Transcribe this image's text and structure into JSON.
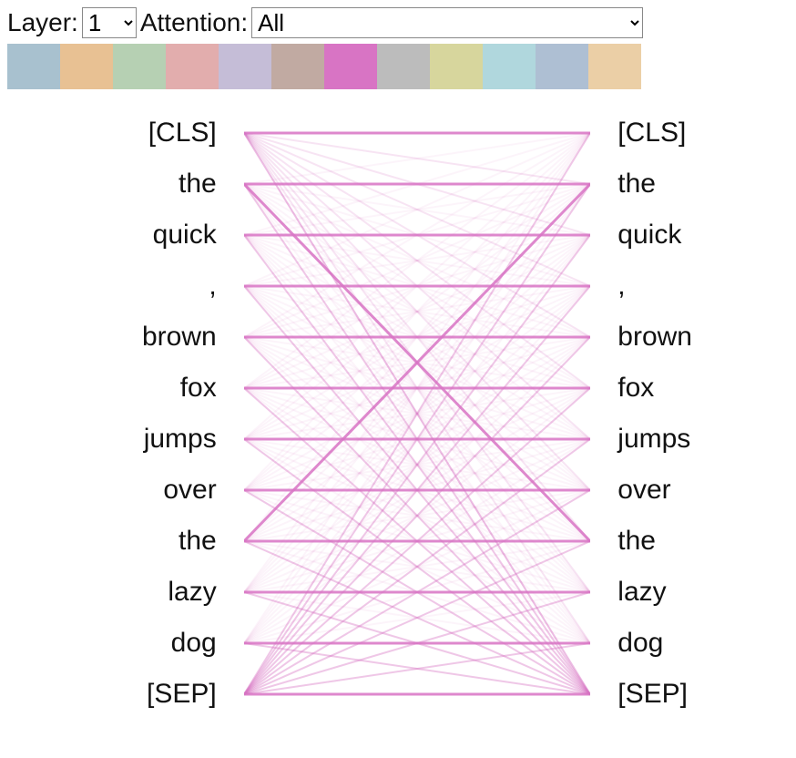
{
  "controls": {
    "layer_label": "Layer:",
    "layer_value": "1",
    "attention_label": "Attention:",
    "attention_value": "All"
  },
  "palette": [
    "#a8c1cf",
    "#e8c193",
    "#b6d0b3",
    "#e2adad",
    "#c5bdd7",
    "#c1aaa2",
    "#d874c4",
    "#bcbcbc",
    "#d7d69d",
    "#b0d7dd",
    "#aebfd3",
    "#ebcfa6"
  ],
  "tokens": [
    "[CLS]",
    "the",
    "quick",
    ",",
    "brown",
    "fox",
    "jumps",
    "over",
    "the",
    "lazy",
    "dog",
    "[SEP]"
  ],
  "lines": {
    "color": "#d874c4",
    "strong": 0.85,
    "mid": 0.35,
    "weak": 0.08
  }
}
